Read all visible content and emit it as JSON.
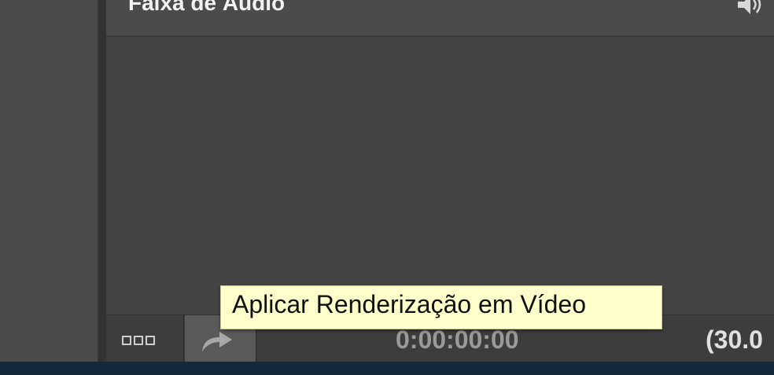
{
  "panel": {
    "title": "Faixa de Áudio"
  },
  "icons": {
    "speaker": "speaker-icon",
    "view_toggle": "grid-view-icon",
    "render": "curved-arrow-icon"
  },
  "bottom_bar": {
    "timecode": "0:00:00:00",
    "fps": "(30.0"
  },
  "tooltip": {
    "text": "Aplicar Renderização em Vídeo"
  },
  "colors": {
    "tooltip_bg": "#ffffcc",
    "panel_bg": "#444444"
  }
}
